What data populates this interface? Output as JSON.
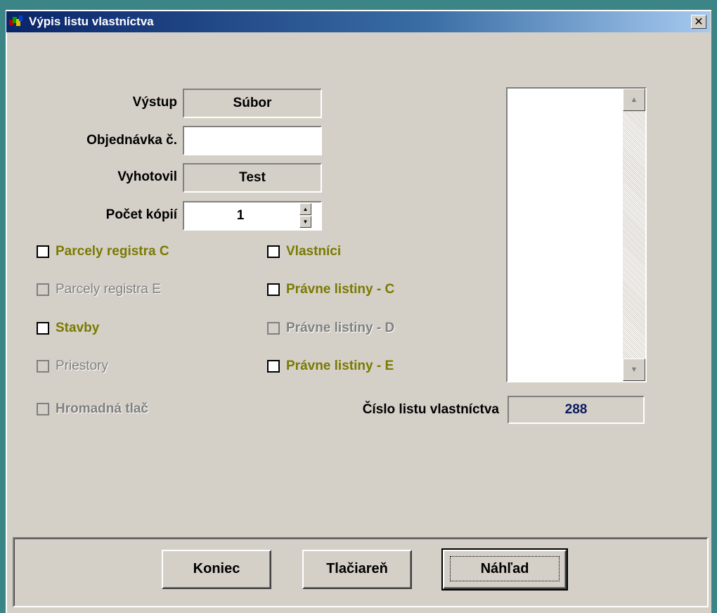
{
  "window": {
    "title": "Výpis listu vlastníctva",
    "close_glyph": "✕"
  },
  "form": {
    "vystup": {
      "label": "Výstup",
      "value": "Súbor"
    },
    "objednavka": {
      "label": "Objednávka č.",
      "value": ""
    },
    "vyhotovil": {
      "label": "Vyhotovil",
      "value": "Test"
    },
    "pocet_kopii": {
      "label": "Počet kópií",
      "value": "1"
    }
  },
  "checkboxes": [
    {
      "label": "Parcely registra C",
      "checked": false,
      "enabled": true
    },
    {
      "label": "Parcely registra E",
      "checked": false,
      "enabled": false
    },
    {
      "label": "Stavby",
      "checked": false,
      "enabled": true
    },
    {
      "label": "Priestory",
      "checked": false,
      "enabled": false
    },
    {
      "label": "Hromadná tlač",
      "checked": false,
      "enabled": false
    },
    {
      "label": "Vlastníci",
      "checked": false,
      "enabled": true
    },
    {
      "label": "Právne listiny - C",
      "checked": false,
      "enabled": true
    },
    {
      "label": "Právne listiny - D",
      "checked": false,
      "enabled": false
    },
    {
      "label": "Právne listiny - E",
      "checked": false,
      "enabled": true
    }
  ],
  "cislo_lv": {
    "label": "Číslo listu vlastníctva",
    "value": "288"
  },
  "buttons": {
    "koniec": {
      "label": "Koniec"
    },
    "tlaciaren": {
      "label": "Tlačiareň"
    },
    "nahlad": {
      "label": "Náhľad"
    }
  },
  "colors": {
    "title_gradient_start": "#0a246a",
    "checkbox_label": "#7a7a00",
    "value_text": "#0a1a60"
  }
}
